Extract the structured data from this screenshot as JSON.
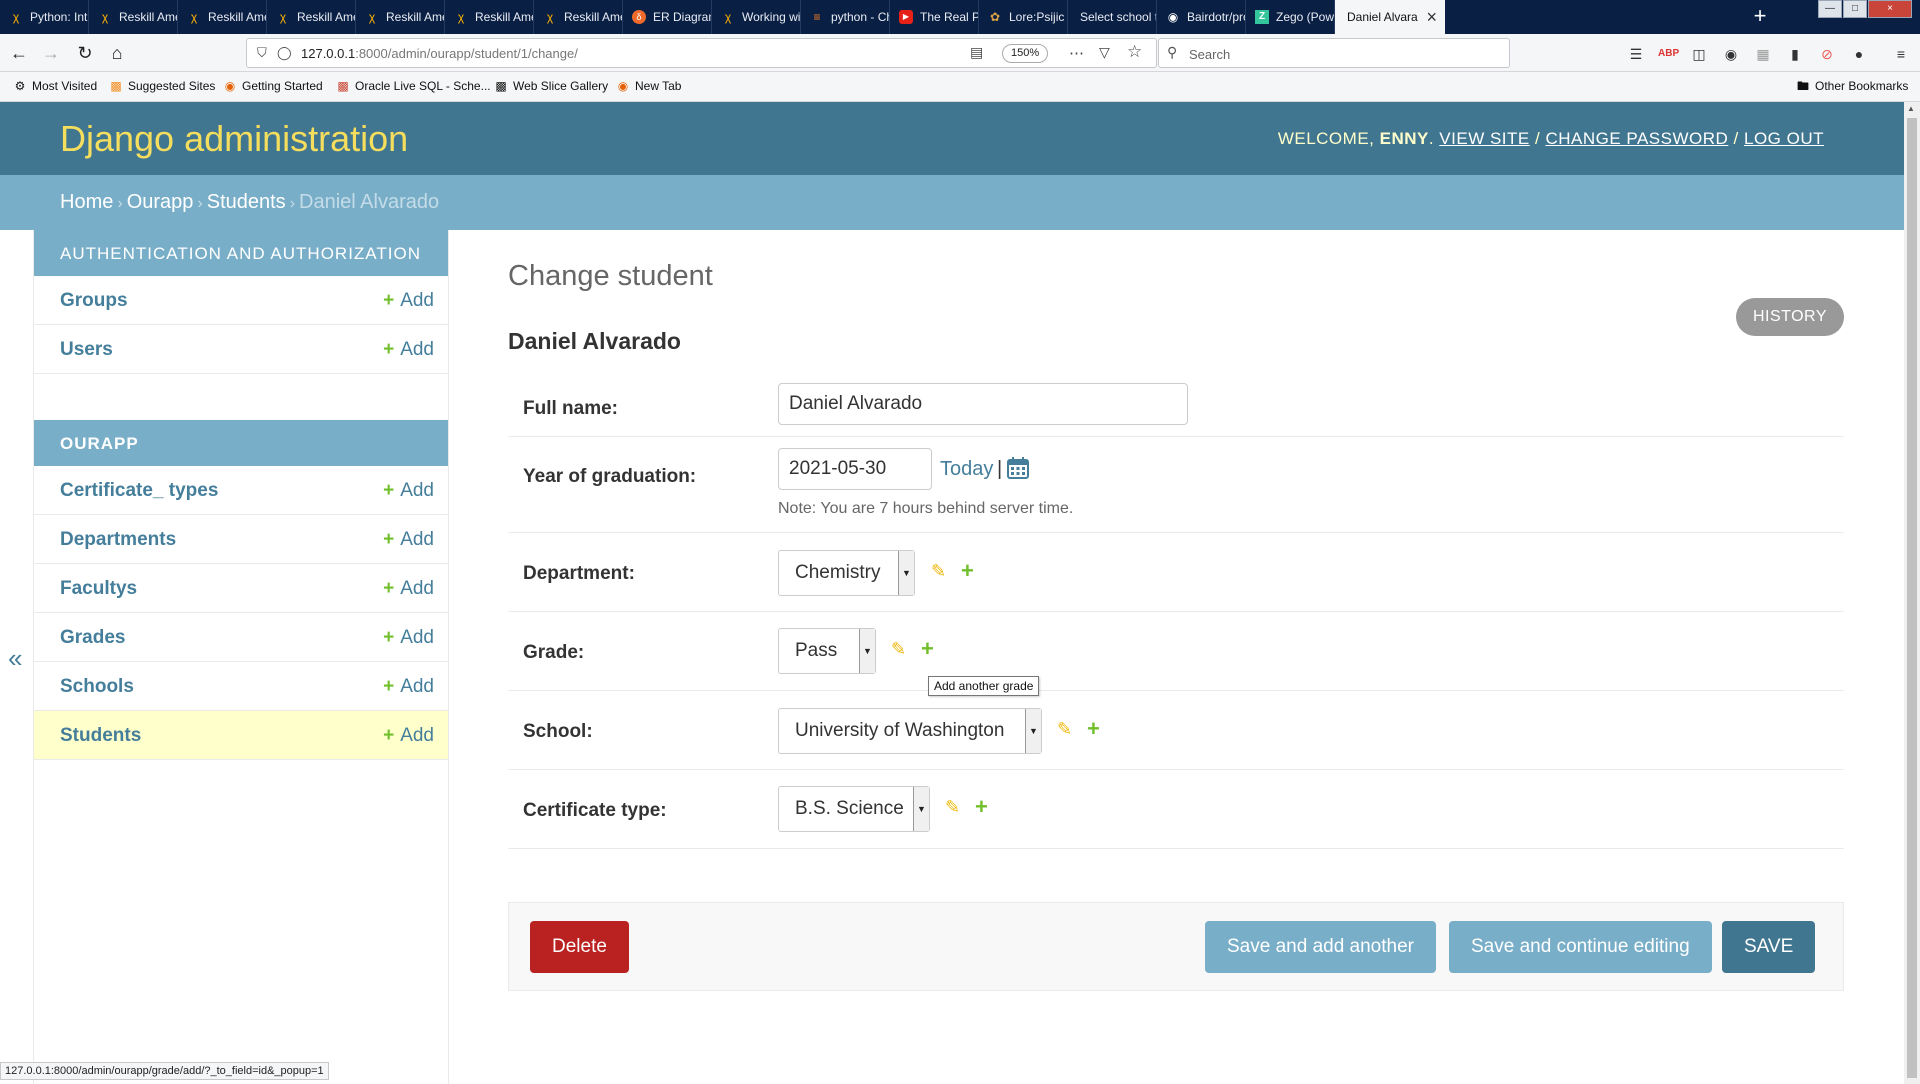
{
  "browser": {
    "tabs": [
      {
        "title": "Python: Intro",
        "icon": "reskill-icon"
      },
      {
        "title": "Reskill Amer",
        "icon": "reskill-icon"
      },
      {
        "title": "Reskill Amer",
        "icon": "reskill-icon"
      },
      {
        "title": "Reskill Amer",
        "icon": "reskill-icon"
      },
      {
        "title": "Reskill Amer",
        "icon": "reskill-icon"
      },
      {
        "title": "Reskill Amer",
        "icon": "reskill-icon"
      },
      {
        "title": "Reskill Amer",
        "icon": "reskill-icon"
      },
      {
        "title": "ER Diagram",
        "icon": "er-diagram-icon"
      },
      {
        "title": "Working wit",
        "icon": "reskill-icon"
      },
      {
        "title": "python - Ch",
        "icon": "stackoverflow-icon"
      },
      {
        "title": "The Real Po",
        "icon": "youtube-icon"
      },
      {
        "title": "Lore:Psijic E",
        "icon": "wiki-icon"
      },
      {
        "title": "Select school to",
        "icon": "none"
      },
      {
        "title": "Bairdotr/pro",
        "icon": "github-icon"
      },
      {
        "title": "Zego (Power",
        "icon": "zego-icon"
      },
      {
        "title": "Daniel Alvara",
        "icon": "django-icon"
      }
    ],
    "url_host": "127.0.0.1",
    "url_path": ":8000/admin/ourapp/student/1/change/",
    "zoom": "150%",
    "search_placeholder": "Search",
    "bookmarks": [
      {
        "label": "Most Visited",
        "icon": "gear-icon"
      },
      {
        "label": "Suggested Sites",
        "icon": "suggested-sites-icon"
      },
      {
        "label": "Getting Started",
        "icon": "firefox-icon"
      },
      {
        "label": "Oracle Live SQL - Sche...",
        "icon": "oracle-icon"
      },
      {
        "label": "Web Slice Gallery",
        "icon": "web-slice-icon"
      },
      {
        "label": "New Tab",
        "icon": "firefox-icon"
      }
    ],
    "other_bookmarks": "Other Bookmarks",
    "status_url": "127.0.0.1:8000/admin/ourapp/grade/add/?_to_field=id&_popup=1"
  },
  "header": {
    "site_title": "Django administration",
    "welcome": "WELCOME,",
    "username": "ENNY",
    "view_site": "VIEW SITE",
    "change_password": "CHANGE PASSWORD",
    "log_out": "LOG OUT"
  },
  "breadcrumbs": {
    "home": "Home",
    "app": "Ourapp",
    "model": "Students",
    "current": "Daniel Alvarado",
    "separator": "›"
  },
  "sidebar": {
    "toggle": "«",
    "add_label": "Add",
    "auth_caption": "Authentication and Authorization",
    "auth_items": [
      "Groups",
      "Users"
    ],
    "app_caption": "Ourapp",
    "app_items": [
      "Certificate_ types",
      "Departments",
      "Facultys",
      "Grades",
      "Schools",
      "Students"
    ],
    "current_item": "Students"
  },
  "content": {
    "title": "Change student",
    "object_name": "Daniel Alvarado",
    "history_button": "HISTORY",
    "fields": {
      "full_name": {
        "label": "Full name:",
        "value": "Daniel Alvarado"
      },
      "year_of_graduation": {
        "label": "Year of graduation:",
        "value": "2021-05-30",
        "today": "Today",
        "separator": "|",
        "note": "Note: You are 7 hours behind server time."
      },
      "department": {
        "label": "Department:",
        "value": "Chemistry"
      },
      "grade": {
        "label": "Grade:",
        "value": "Pass",
        "tooltip": "Add another grade"
      },
      "school": {
        "label": "School:",
        "value": "University of Washington"
      },
      "certificate_type": {
        "label": "Certificate type:",
        "value": "B.S. Science"
      }
    },
    "buttons": {
      "delete": "Delete",
      "save_add_another": "Save and add another",
      "save_continue": "Save and continue editing",
      "save": "SAVE"
    }
  },
  "colors": {
    "header_bg": "#417690",
    "site_title": "#f5dd5d",
    "breadcrumb_bg": "#79aec8",
    "link": "#447e9b",
    "add_plus": "#70bf2b",
    "change_pencil": "#efb80b",
    "delete_button": "#ba2121",
    "current_row": "#ffffcc"
  }
}
